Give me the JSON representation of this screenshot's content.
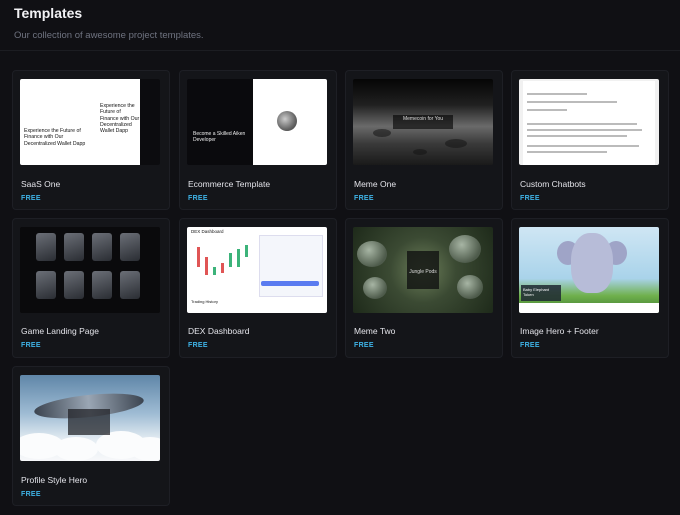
{
  "header": {
    "title": "Templates",
    "subtitle": "Our collection of awesome project templates."
  },
  "templates": [
    {
      "name": "SaaS One",
      "price": "FREE",
      "thumb_text": [
        "Experience the Future of Finance with Our Decentralized Wallet Dapp",
        "Experience the Future of Finance with Our Decentralized Wallet Dapp"
      ]
    },
    {
      "name": "Ecommerce Template",
      "price": "FREE",
      "thumb_text": [
        "Become a Skilled Aiken Developer",
        "Comprehensive Aiken Development Course"
      ]
    },
    {
      "name": "Meme One",
      "price": "FREE",
      "thumb_text": [
        "Memecoin for You"
      ]
    },
    {
      "name": "Custom Chatbots",
      "price": "FREE"
    },
    {
      "name": "Game Landing Page",
      "price": "FREE"
    },
    {
      "name": "DEX Dashboard",
      "price": "FREE",
      "thumb_text": [
        "DEX Dashboard",
        "Trading History"
      ]
    },
    {
      "name": "Meme Two",
      "price": "FREE",
      "thumb_text": [
        "Jungle Pods"
      ]
    },
    {
      "name": "Image Hero + Footer",
      "price": "FREE",
      "thumb_text": [
        "Baby Elephant Token"
      ]
    },
    {
      "name": "Profile Style Hero",
      "price": "FREE"
    }
  ]
}
